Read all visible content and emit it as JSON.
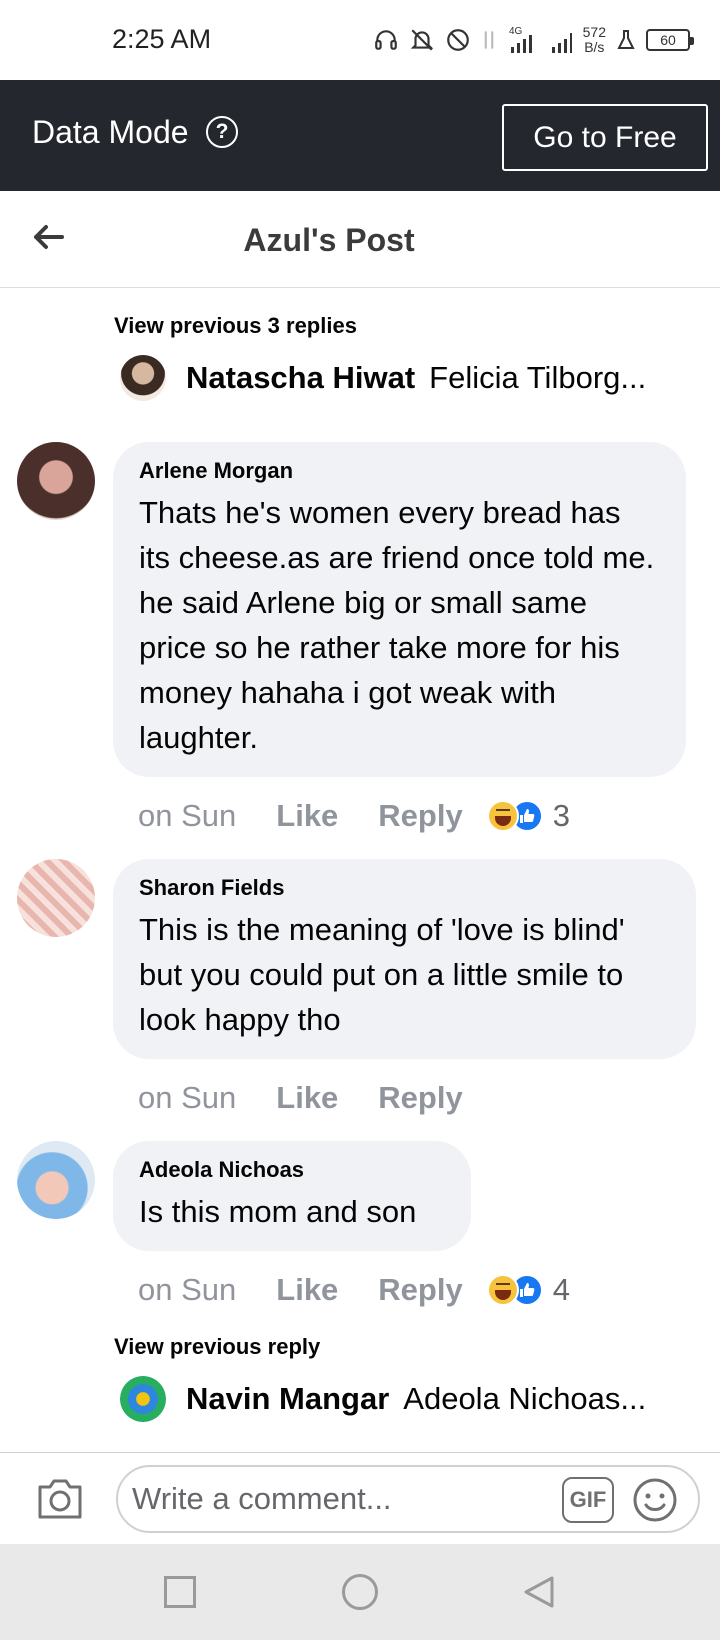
{
  "status_bar": {
    "time": "2:25 AM",
    "net_speed_value": "572",
    "net_speed_unit": "B/s",
    "battery": "60",
    "icons": [
      "headset-icon",
      "bell-off-icon",
      "do-not-disturb-icon",
      "data-arrows-icon",
      "signal-4g-icon",
      "signal-icon",
      "flask-icon",
      "battery-icon"
    ]
  },
  "data_mode": {
    "label": "Data Mode",
    "help_icon": "?",
    "button": "Go to Free"
  },
  "header": {
    "title": "Azul's Post",
    "back_icon": "arrow-left-icon"
  },
  "thread": {
    "view_previous_top": "View previous 3 replies",
    "reply_top": {
      "name": "Natascha Hiwat",
      "text": "Felicia Tilborg..."
    },
    "comments": [
      {
        "name": "Arlene Morgan",
        "text": "Thats he's women every bread has its cheese.as are friend once told me. he said Arlene big or small same price so he rather take more for his money hahaha i got weak with laughter.",
        "time": "on Sun",
        "like": "Like",
        "reply": "Reply",
        "reaction_count": "3"
      },
      {
        "name": "Sharon Fields",
        "text": "This is the meaning of 'love is blind' but you could put on a little smile to look happy tho",
        "time": "on Sun",
        "like": "Like",
        "reply": "Reply",
        "reaction_count": ""
      },
      {
        "name": "Adeola Nichoas",
        "text": "Is this mom and son",
        "time": "on Sun",
        "like": "Like",
        "reply": "Reply",
        "reaction_count": "4"
      }
    ],
    "view_previous_bottom": "View previous reply",
    "reply_bottom": {
      "name": "Navin Mangar",
      "text": "Adeola Nichoas..."
    }
  },
  "composer": {
    "placeholder": "Write a comment...",
    "gif_label": "GIF"
  },
  "colors": {
    "data_mode_bg": "#24272e",
    "bubble_bg": "#f0f2f5",
    "like_blue": "#1877f2",
    "haha_yellow": "#f7c23c"
  }
}
